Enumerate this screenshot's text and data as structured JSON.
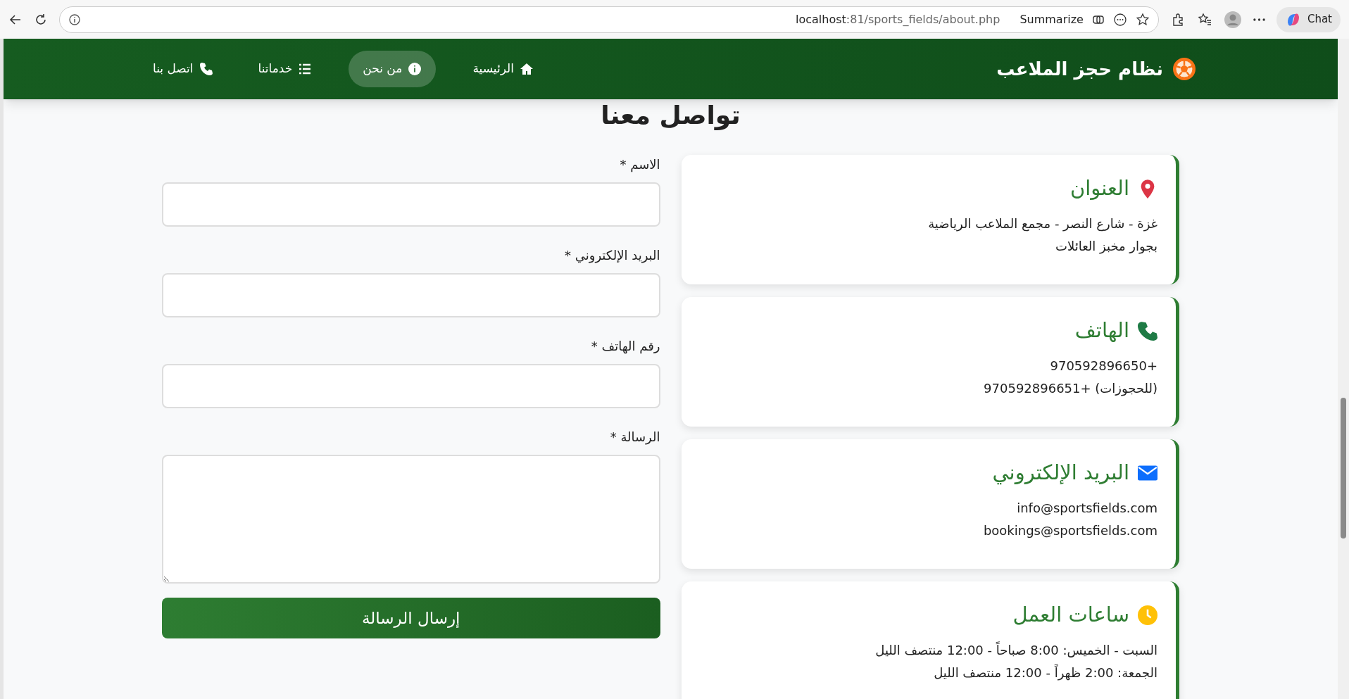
{
  "browser": {
    "url_host": "localhost",
    "url_path": ":81/sports_fields/about.php",
    "summarize": "Summarize",
    "chat": "Chat"
  },
  "navbar": {
    "brand": "نظام حجز الملاعب",
    "items": [
      {
        "label": "الرئيسية",
        "kind": "home",
        "selected": false
      },
      {
        "label": "من نحن",
        "kind": "info",
        "selected": true
      },
      {
        "label": "خدماتنا",
        "kind": "list",
        "selected": false
      },
      {
        "label": "اتصل بنا",
        "kind": "phone",
        "selected": false
      }
    ]
  },
  "heading": "تواصل معنا",
  "cards": [
    {
      "kind": "pin",
      "title": "العنوان",
      "lines": [
        "غزة - شارع النصر - مجمع الملاعب الرياضية",
        "بجوار مخبز العائلات"
      ]
    },
    {
      "kind": "phone",
      "title": "الهاتف",
      "lines": [
        "970592896650+",
        "970592896651+ (للحجوزات)"
      ]
    },
    {
      "kind": "envelope",
      "title": "البريد الإلكتروني",
      "lines": [
        "info@sportsfields.com",
        "bookings@sportsfields.com"
      ]
    },
    {
      "kind": "clock",
      "title": "ساعات العمل",
      "lines": [
        "السبت - الخميس: 8:00 صباحاً - 12:00 منتصف الليل",
        "الجمعة: 2:00 ظهراً - 12:00 منتصف الليل"
      ]
    }
  ],
  "form": {
    "fields": [
      {
        "label": "الاسم *",
        "kind": "input"
      },
      {
        "label": "البريد الإلكتروني *",
        "kind": "input"
      },
      {
        "label": "رقم الهاتف *",
        "kind": "input"
      },
      {
        "label": "الرسالة *",
        "kind": "textarea"
      }
    ],
    "submit": "إرسال الرسالة"
  }
}
